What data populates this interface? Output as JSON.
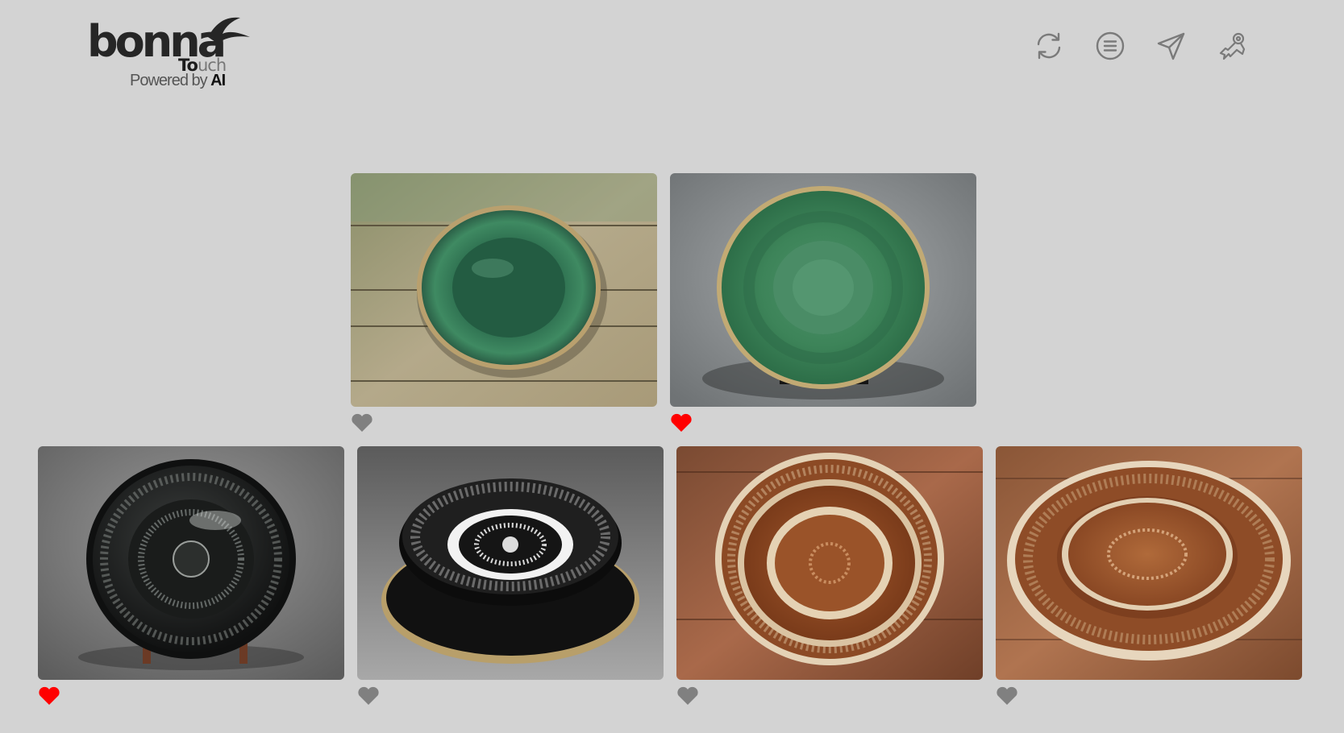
{
  "brand": {
    "name": "bonna",
    "touch_bold": "To",
    "touch_light": "uch",
    "powered_by": "Powered by ",
    "powered_ai": "AI"
  },
  "toolbar": [
    {
      "icon": "refresh-icon"
    },
    {
      "icon": "list-icon"
    },
    {
      "icon": "send-icon"
    },
    {
      "icon": "settings-key-icon"
    }
  ],
  "colors": {
    "background": "#d3d3d3",
    "heart_liked": "#ff0000",
    "heart_default": "#808080",
    "icon": "#7a7a7a"
  },
  "gallery": [
    {
      "name": "green-rustic-plate-on-wood",
      "liked": false
    },
    {
      "name": "green-patterned-plate-on-stand",
      "liked": true
    },
    {
      "name": "black-engraved-plate-on-stand",
      "liked": true
    },
    {
      "name": "black-white-bowl-on-plate",
      "liked": false
    },
    {
      "name": "brown-engraved-plate-set-on-wood",
      "liked": false
    },
    {
      "name": "brown-engraved-stacked-plates-on-wood",
      "liked": false
    }
  ]
}
